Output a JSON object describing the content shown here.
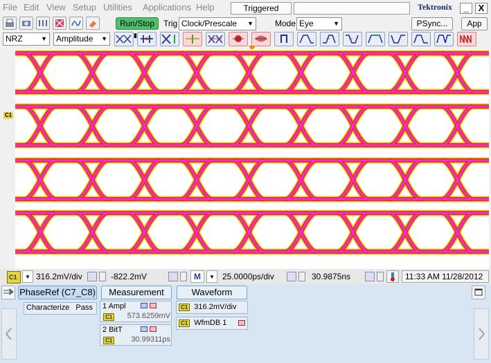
{
  "menu": [
    "File",
    "Edit",
    "View",
    "Setup",
    "Utilities",
    "Applications",
    "Help"
  ],
  "trigger_status": "Triggered",
  "brand": "Tektronix",
  "window": {
    "minimize": "_",
    "close": "X"
  },
  "toolbar1": {
    "run_stop": "Run/Stop",
    "trig_label": "Trig",
    "trig_source": "Clock/Prescale",
    "mode_label": "Mode",
    "mode_value": "Eye",
    "psync": "PSync...",
    "app": "App"
  },
  "toolbar2": {
    "signal_type": "NRZ",
    "measure_type": "Amplitude"
  },
  "scope": {
    "channel_marker": "C1"
  },
  "readout": {
    "channel": "C1",
    "vertical_scale": "316.2mV/div",
    "offset": "-822.2mV",
    "math_label": "M",
    "horizontal_scale": "25.0000ps/div",
    "position": "30.9875ns",
    "datetime": "11:33 AM 11/28/2012"
  },
  "panel": {
    "phase_ref": "PhaseRef (C7_C8)",
    "measurement_tab": "Measurement",
    "waveform_tab": "Waveform",
    "characterize": "Characterize",
    "pass": "Pass",
    "measurements": [
      {
        "name": "1 Ampl",
        "channel": "C1",
        "value": "573.6259mV"
      },
      {
        "name": "2 BitT",
        "channel": "C1",
        "value": "30.99311ps"
      }
    ],
    "waveforms": [
      {
        "channel": "C1",
        "label": "316.2mV/div"
      },
      {
        "channel": "C1",
        "label": "WfmDB 1"
      }
    ]
  },
  "colors": {
    "eye_outer": "#e8c800",
    "eye_mid": "#e02020",
    "eye_inner": "#e020e0",
    "eye_core": "#ff3a9a",
    "run_stop": "#4fc16b"
  }
}
